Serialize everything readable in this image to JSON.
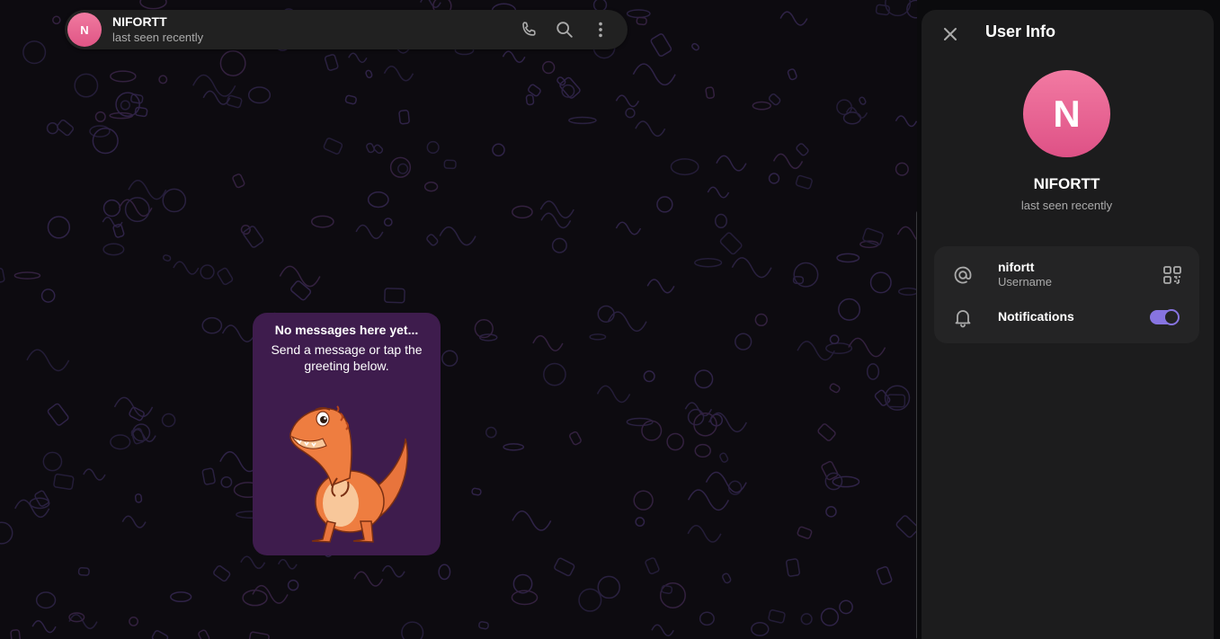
{
  "chat": {
    "peer_initial": "N",
    "peer_name": "NIFORTT",
    "peer_status": "last seen recently",
    "actions": [
      {
        "icon": "phone-icon"
      },
      {
        "icon": "search-icon"
      },
      {
        "icon": "more-vertical-icon"
      }
    ],
    "empty_state": {
      "title": "No messages here yet...",
      "subtitle": "Send a message or tap the greeting below.",
      "sticker": "dinosaur-sticker"
    }
  },
  "user_info": {
    "title": "User Info",
    "close_icon": "close-icon",
    "avatar_initial": "N",
    "name": "NIFORTT",
    "status": "last seen recently",
    "username": {
      "value": "nifortt",
      "label": "Username",
      "icon": "at-icon",
      "action_icon": "qr-code-icon"
    },
    "notifications": {
      "label": "Notifications",
      "icon": "bell-icon",
      "enabled": true
    }
  },
  "colors": {
    "accent": "#8774e1",
    "avatar": "#e86a95",
    "panel_bg": "#1c1c1d",
    "card_bg": "#3e1c4d"
  }
}
